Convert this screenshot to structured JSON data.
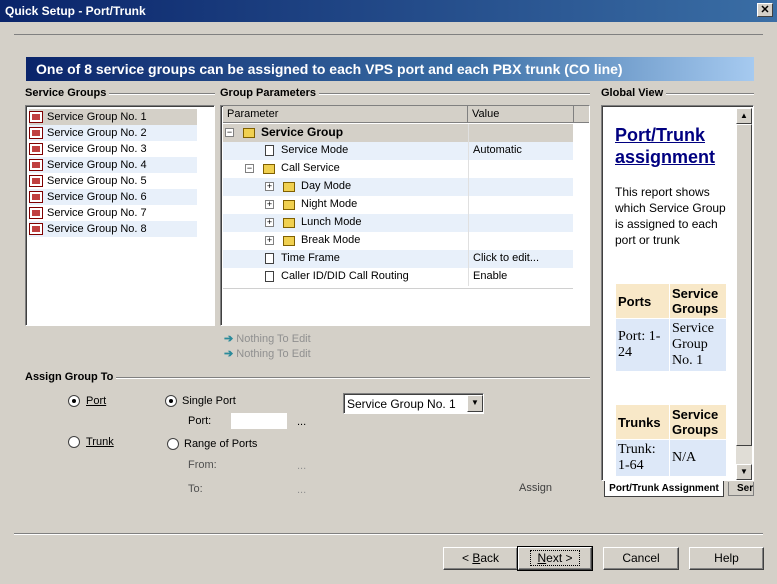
{
  "window": {
    "title": "Quick Setup - Port/Trunk",
    "close_glyph": "✕"
  },
  "banner": "One of 8 service groups can be assigned to each VPS port and each PBX trunk (CO line)",
  "service_groups": {
    "header": "Service Groups",
    "items": [
      "Service Group No. 1",
      "Service Group No. 2",
      "Service Group No. 3",
      "Service Group No. 4",
      "Service Group No. 5",
      "Service Group No. 6",
      "Service Group No. 7",
      "Service Group No. 8"
    ]
  },
  "group_parameters": {
    "header": "Group Parameters",
    "col_parameter": "Parameter",
    "col_value": "Value",
    "rows": [
      {
        "label": "Service Group",
        "value": ""
      },
      {
        "label": "Service Mode",
        "value": "Automatic"
      },
      {
        "label": "Call Service",
        "value": ""
      },
      {
        "label": "Day Mode",
        "value": ""
      },
      {
        "label": "Night Mode",
        "value": ""
      },
      {
        "label": "Lunch Mode",
        "value": ""
      },
      {
        "label": "Break Mode",
        "value": ""
      },
      {
        "label": "Time Frame",
        "value": "Click to edit..."
      },
      {
        "label": "Caller ID/DID Call Routing",
        "value": "Enable"
      }
    ],
    "nothing_to_edit_1": "Nothing To Edit",
    "nothing_to_edit_2": "Nothing To Edit"
  },
  "global_view": {
    "header": "Global View",
    "title_line1": "Port/Trunk",
    "title_line2": "assignment",
    "desc": "This report shows which Service Group is assigned to each port or trunk",
    "ports_header": "Ports",
    "ports_sg_header": "Service Groups",
    "ports_value": "Port: 1-24",
    "ports_sg_value": "Service Group No. 1",
    "trunks_header": "Trunks",
    "trunks_sg_header": "Service Groups",
    "trunks_value": "Trunk: 1-64",
    "trunks_sg_value": "N/A",
    "tab1": "Port/Trunk Assignment",
    "tab2": "Ser"
  },
  "assign": {
    "header": "Assign Group To",
    "port": "Port",
    "trunk": "Trunk",
    "single_port": "Single Port",
    "port_label": "Port:",
    "port_value": "",
    "range": "Range of Ports",
    "from": "From:",
    "to": "To:",
    "ellipsis": "...",
    "select_value": "Service Group No. 1",
    "assign_button": "Assign",
    "selected_target": "Port",
    "selected_mode": "Single Port"
  },
  "footer": {
    "back": "< Back",
    "next": "Next >",
    "cancel": "Cancel",
    "help": "Help"
  }
}
